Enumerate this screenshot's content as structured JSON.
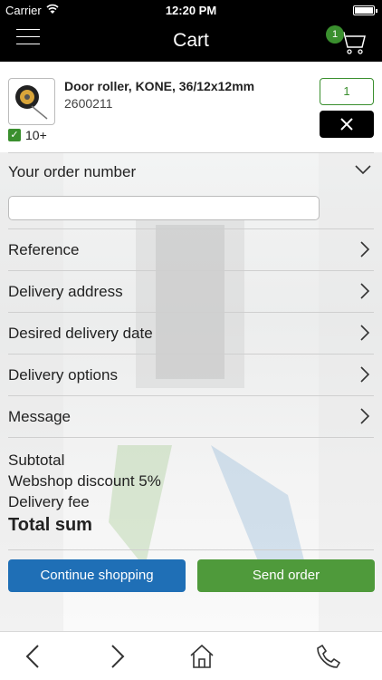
{
  "status_bar": {
    "carrier": "Carrier",
    "time": "12:20 PM"
  },
  "nav": {
    "title": "Cart",
    "cart_count": "1"
  },
  "product": {
    "name": "Door roller, KONE, 36/12x12mm",
    "sku": "2600211",
    "stock": "10+",
    "quantity": "1"
  },
  "sections": {
    "order_number": "Your order number",
    "reference": "Reference",
    "delivery_address": "Delivery address",
    "delivery_date": "Desired delivery date",
    "delivery_options": "Delivery options",
    "message": "Message"
  },
  "summary": {
    "subtotal": "Subtotal",
    "discount": "Webshop discount 5%",
    "delivery_fee": "Delivery fee",
    "total": "Total sum"
  },
  "buttons": {
    "continue": "Continue shopping",
    "send": "Send order"
  },
  "colors": {
    "accent_green": "#3a8f2e",
    "button_blue": "#1f6fb6",
    "button_green": "#4f9a3b"
  },
  "icons": [
    "menu-icon",
    "cart-icon",
    "close-icon",
    "chevron-down-icon",
    "chevron-right-icon",
    "back-icon",
    "forward-icon",
    "home-icon",
    "phone-icon"
  ]
}
